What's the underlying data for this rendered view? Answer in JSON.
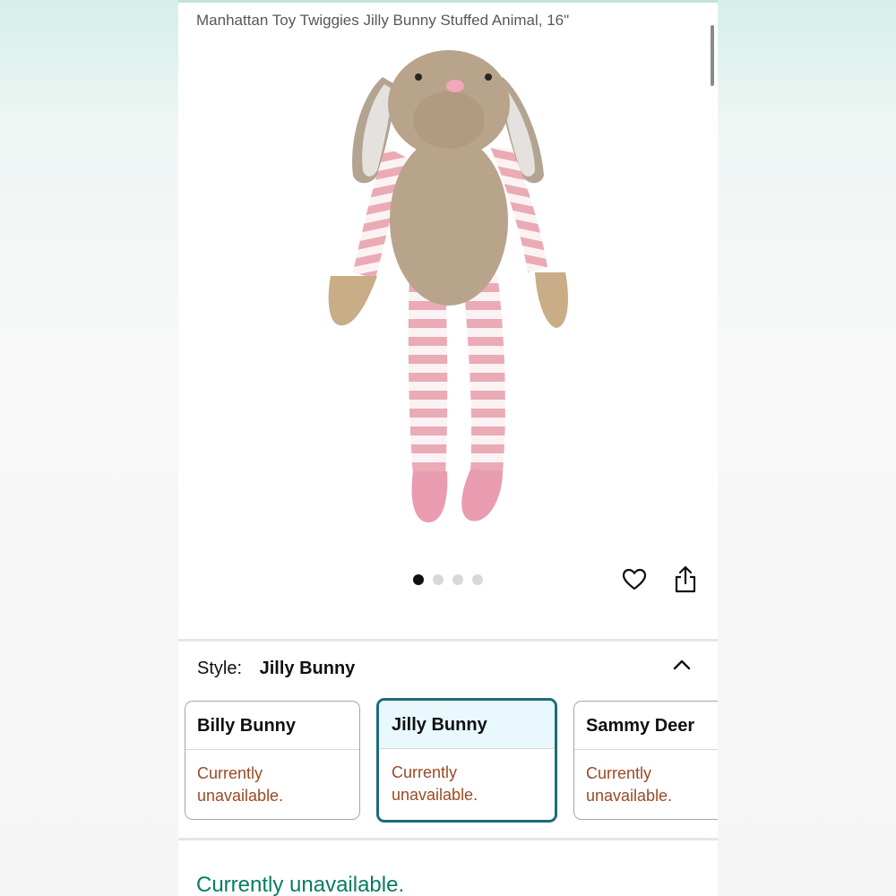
{
  "product": {
    "title": "Manhattan Toy Twiggies Jilly Bunny Stuffed Animal, 16\"",
    "image_icon": "stuffed-bunny-image"
  },
  "gallery": {
    "image_count": 4,
    "active_index": 0
  },
  "actions": {
    "wishlist_icon": "heart-icon",
    "share_icon": "share-icon"
  },
  "style": {
    "label": "Style:",
    "selected_value": "Jilly Bunny",
    "options": [
      {
        "name": "Billy Bunny",
        "status_line1": "Currently",
        "status_line2": "unavailable."
      },
      {
        "name": "Jilly Bunny",
        "status_line1": "Currently",
        "status_line2": "unavailable."
      },
      {
        "name": "Sammy Deer",
        "status_line1": "Currently",
        "status_line2": "unavailable."
      }
    ]
  },
  "availability": {
    "text": "Currently unavailable."
  },
  "colors": {
    "selected_border": "#1e6b7a",
    "selected_fill": "#e8f8fc",
    "unavailable_text": "#9b4a25",
    "availability_text": "#067d62"
  }
}
